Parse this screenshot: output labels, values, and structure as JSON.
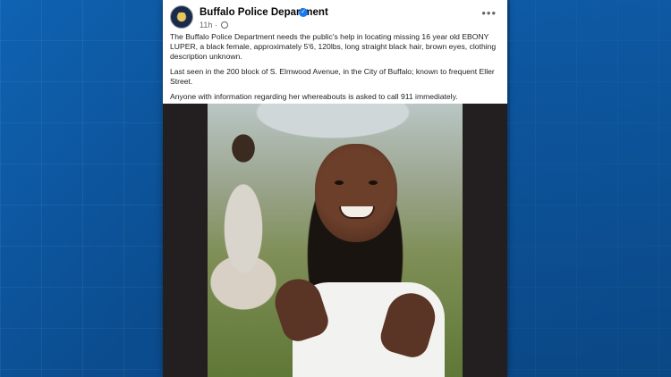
{
  "post": {
    "page_name": "Buffalo Police Department",
    "time": "11h",
    "verified_icon": "verified-badge-icon",
    "privacy_icon": "globe-icon",
    "more_icon": "more-options-icon",
    "paragraphs": [
      "The Buffalo Police Department needs the public's help in locating missing 16 year old EBONY LUPER, a black female, approximately 5'6, 120lbs, long straight black hair, brown eyes, clothing description unknown.",
      "Last seen in the 200 block of S. Elmwood Avenue, in the City of Buffalo; known to frequent Eller Street.",
      "Anyone with information regarding her whereabouts is asked to call 911 immediately."
    ]
  },
  "colors": {
    "background_blue": "#0c4f93",
    "post_background": "#ffffff",
    "verified_blue": "#1877f2",
    "meta_gray": "#65676b"
  }
}
